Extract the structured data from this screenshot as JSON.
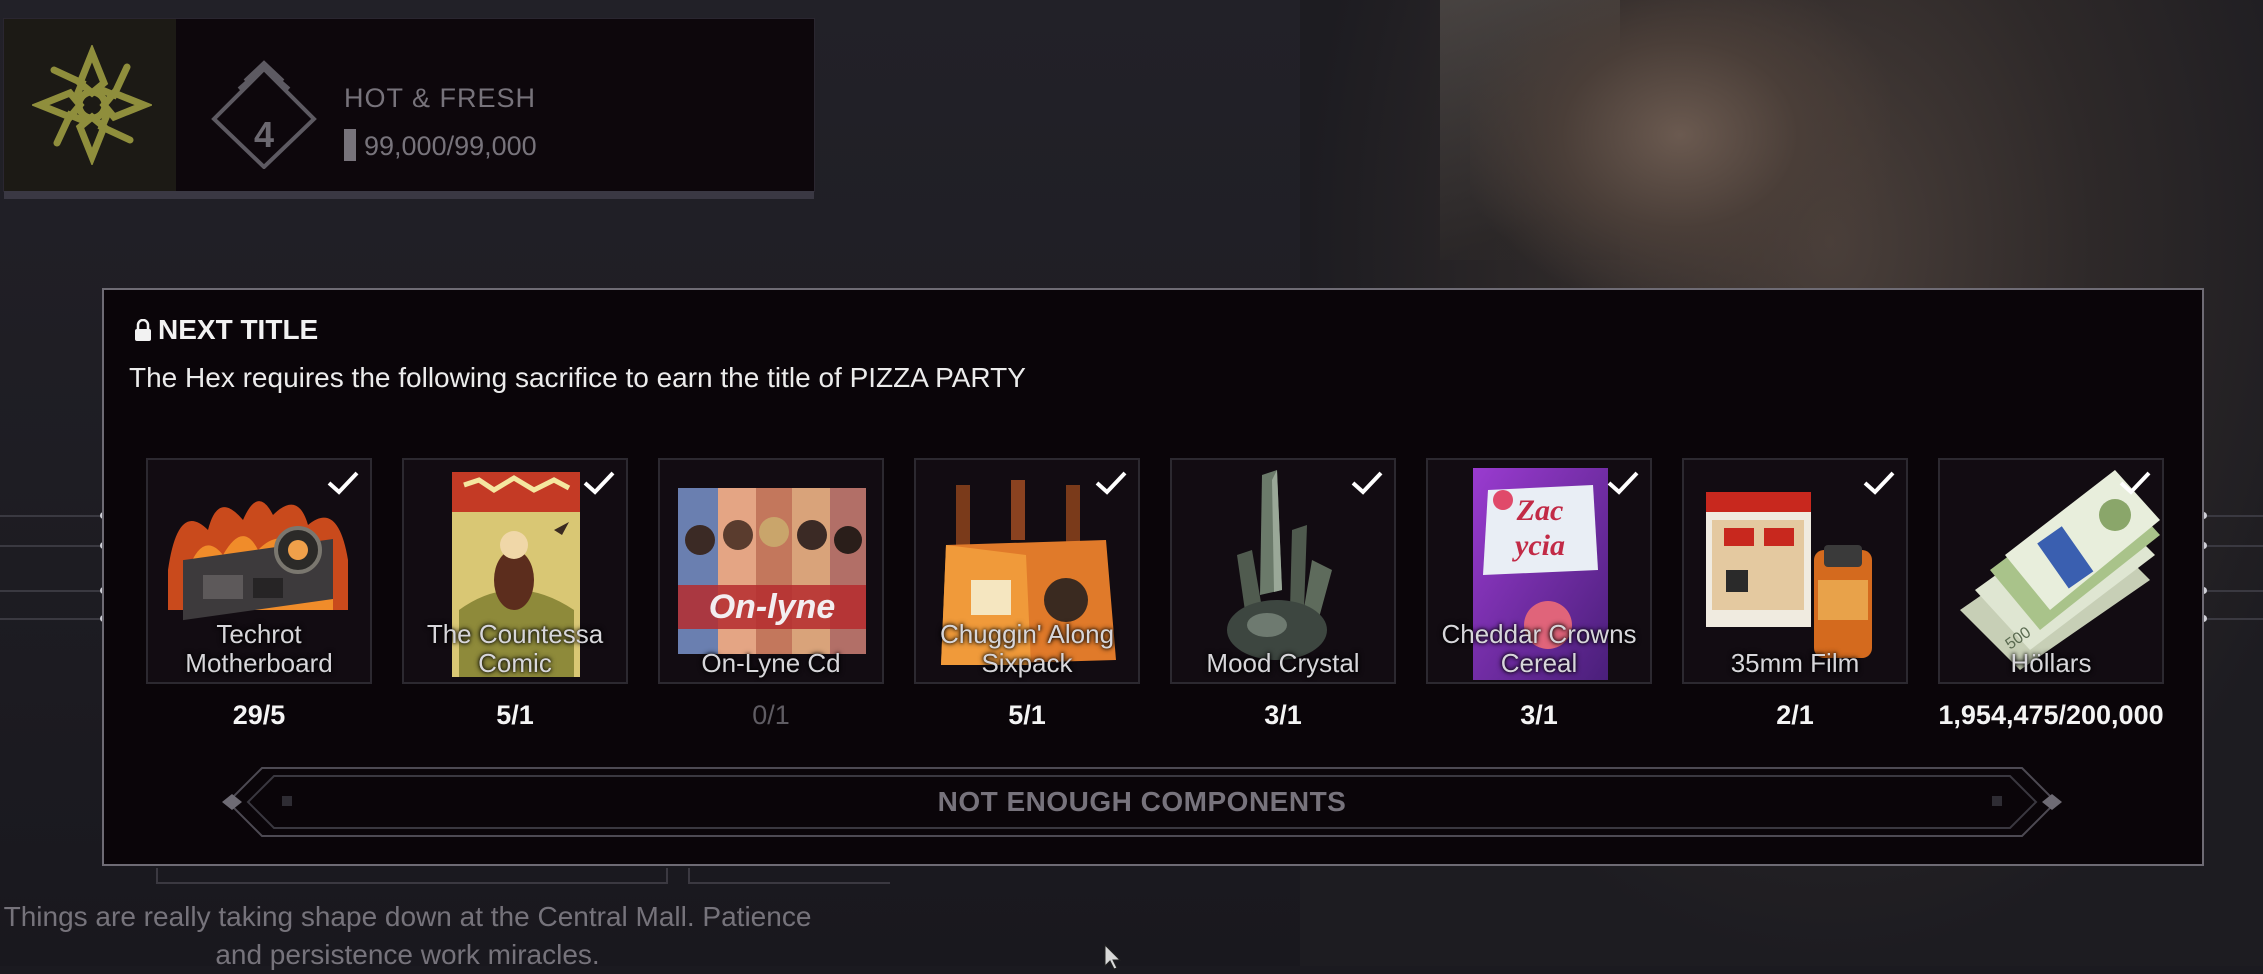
{
  "header": {
    "rank": "4",
    "title_name": "HOT & FRESH",
    "currency": "99,000/99,000",
    "emblem_icon": "hex-emblem-icon",
    "currency_icon": "cash-stack-icon"
  },
  "modal": {
    "heading": "NEXT TITLE",
    "heading_icon": "lock-icon",
    "requirement_text": "The Hex requires the following sacrifice to earn the title of PIZZA PARTY",
    "items": [
      {
        "name": "Techrot Motherboard",
        "count": "29/5",
        "met": true
      },
      {
        "name": "The Countessa Comic",
        "count": "5/1",
        "met": true
      },
      {
        "name": "On-Lyne Cd",
        "count": "0/1",
        "met": false
      },
      {
        "name": "Chuggin' Along Sixpack",
        "count": "5/1",
        "met": true
      },
      {
        "name": "Mood Crystal",
        "count": "3/1",
        "met": true
      },
      {
        "name": "Cheddar Crowns Cereal",
        "count": "3/1",
        "met": true
      },
      {
        "name": "35mm Film",
        "count": "2/1",
        "met": true
      },
      {
        "name": "Höllars",
        "count": "1,954,475/200,000",
        "met": true
      }
    ],
    "craft_button": "NOT ENOUGH COMPONENTS"
  },
  "footer": {
    "text": "Things are really taking shape down at the Central Mall. Patience and persistence work miracles."
  },
  "colors": {
    "panel_bg": "#0a0509",
    "panel_border": "#6e6b74",
    "text_primary": "#f2f2f2",
    "text_dim": "#77737b",
    "emblem": "#8a8a3a"
  }
}
